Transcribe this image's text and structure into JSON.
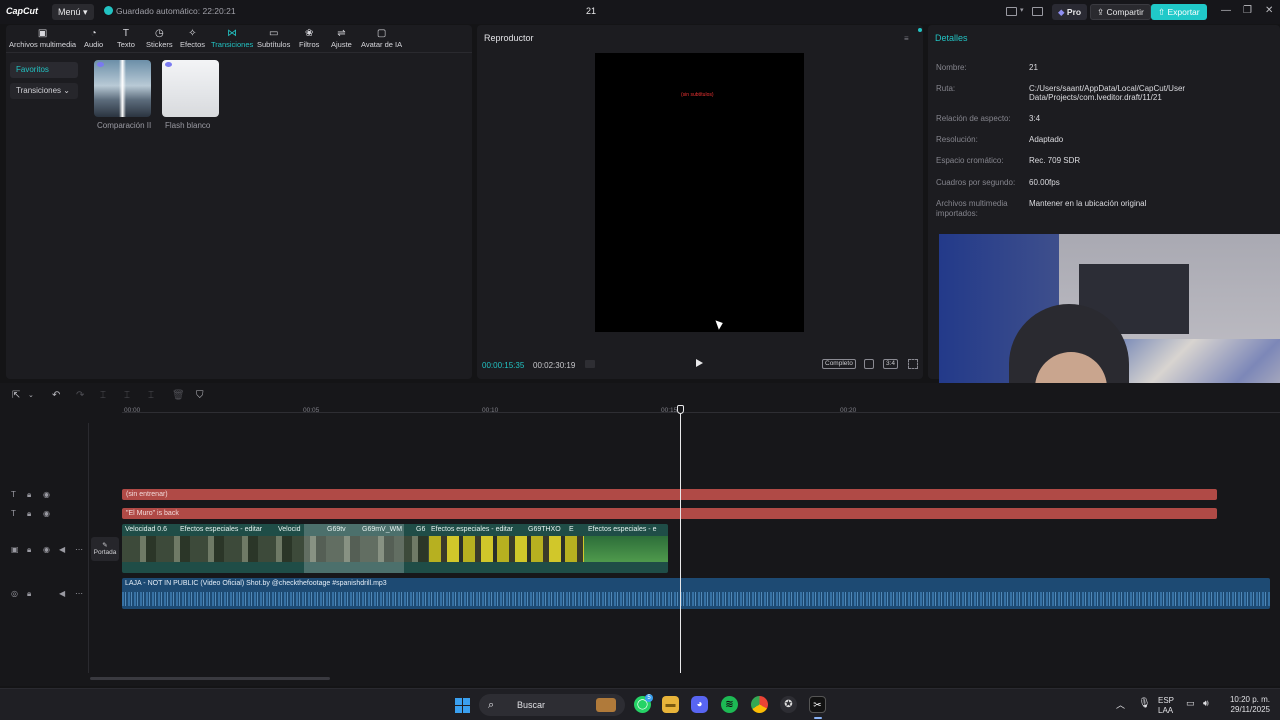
{
  "titlebar": {
    "logo": "CapCut",
    "menu_label": "Menú ▾",
    "autosave": "Guardado automático: 22:20:21",
    "project_name": "21",
    "pro_label": "Pro",
    "share_label": "Compartir",
    "export_label": "Exportar",
    "minimize": "—",
    "restore": "❐",
    "close": "✕"
  },
  "toolbar": {
    "items": [
      {
        "label": "Archivos multimedia",
        "icon": "media-icon",
        "glyph": "▣"
      },
      {
        "label": "Audio",
        "icon": "audio-icon",
        "glyph": "◔"
      },
      {
        "label": "Texto",
        "icon": "text-icon",
        "glyph": "T"
      },
      {
        "label": "Stickers",
        "icon": "sticker-icon",
        "glyph": "◷"
      },
      {
        "label": "Efectos",
        "icon": "effects-icon",
        "glyph": "✧"
      },
      {
        "label": "Transiciones",
        "icon": "transitions-icon",
        "glyph": "⋈"
      },
      {
        "label": "Subtítulos",
        "icon": "subtitles-icon",
        "glyph": "▭"
      },
      {
        "label": "Filtros",
        "icon": "filters-icon",
        "glyph": "❀"
      },
      {
        "label": "Ajuste",
        "icon": "adjust-icon",
        "glyph": "⇌"
      },
      {
        "label": "Avatar de IA",
        "icon": "ai-avatar-icon",
        "glyph": "▢"
      }
    ],
    "active_index": 5
  },
  "sidebar": {
    "favorites": "Favoritos",
    "transitions": "Transiciones ⌄"
  },
  "library": {
    "items": [
      {
        "label": "Comparación II"
      },
      {
        "label": "Flash blanco"
      }
    ]
  },
  "player": {
    "title": "Reproductor",
    "canvas_text": "(sin subtítulos)",
    "current_time": "00:00:15:35",
    "total_time": "00:02:30:19",
    "full_label": "Completo",
    "ratio_label": "3:4"
  },
  "details": {
    "title": "Detalles",
    "rows": [
      {
        "label": "Nombre:",
        "value": "21"
      },
      {
        "label": "Ruta:",
        "value": "C:/Users/saant/AppData/Local/CapCut/User Data/Projects/com.lveditor.draft/11/21"
      },
      {
        "label": "Relación de aspecto:",
        "value": "3:4"
      },
      {
        "label": "Resolución:",
        "value": "Adaptado"
      },
      {
        "label": "Espacio cromático:",
        "value": "Rec. 709 SDR"
      },
      {
        "label": "Cuadros por segundo:",
        "value": "60.00fps"
      },
      {
        "label": "Archivos multimedia importados:",
        "value": "Mantener en la ubicación original"
      }
    ]
  },
  "timeline": {
    "ruler": [
      "00:00",
      "00:05",
      "00:10",
      "00:15",
      "00:20"
    ],
    "text_tracks": [
      "(sin entrenar)",
      "\"El Muro\" is back"
    ],
    "video_labels": [
      "Velocidad 0.6",
      "Efectos especiales - editar",
      "Velocid",
      "G69tv",
      "G69mV_WM",
      "G6",
      "Efectos especiales - editar",
      "G69THXO",
      "E",
      "Efectos especiales - e"
    ],
    "cover_label": "Portada",
    "audio_label": "LAJA - NOT IN PUBLIC (Video Oficial) Shot.by @checkthefootage  #spanishdrill.mp3"
  },
  "taskbar": {
    "search_placeholder": "Buscar",
    "lang_top": "ESP",
    "lang_bottom": "LAA",
    "time": "10:20 p. m.",
    "date": "29/11/2025",
    "whatsapp_badge": "5"
  },
  "colors": {
    "accent": "#22c2c2",
    "text_clip": "#b04a46",
    "video_clip": "#1f4d47",
    "audio_clip": "#1d4a73"
  }
}
